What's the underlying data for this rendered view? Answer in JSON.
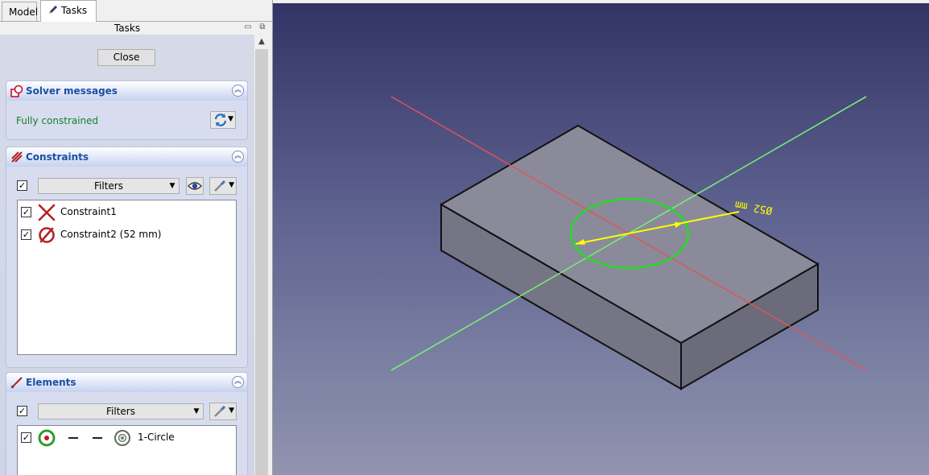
{
  "tabs": [
    {
      "label": "Model",
      "active": false
    },
    {
      "label": "Tasks",
      "active": true
    }
  ],
  "panel": {
    "title": "Tasks",
    "close_label": "Close"
  },
  "solver": {
    "title": "Solver messages",
    "status": "Fully constrained",
    "status_color": "#16802e"
  },
  "constraints": {
    "title": "Constraints",
    "filter_label": "Filters",
    "items": [
      {
        "label": "Constraint1",
        "checked": true,
        "icon": "coincident-constraint-icon"
      },
      {
        "label": "Constraint2 (52 mm)",
        "checked": true,
        "icon": "diameter-constraint-icon"
      }
    ]
  },
  "elements": {
    "title": "Elements",
    "filter_label": "Filters",
    "items": [
      {
        "label": "1-Circle",
        "checked": true,
        "icon": "circle-element-icon"
      }
    ]
  },
  "viewport": {
    "dimension_label": "Ø52 mm",
    "colors": {
      "x_axis": "#e05555",
      "y_axis": "#77ee77",
      "circle": "#22dd22",
      "dimension": "#ffff00",
      "box_fill": "#8a8a9a"
    }
  }
}
